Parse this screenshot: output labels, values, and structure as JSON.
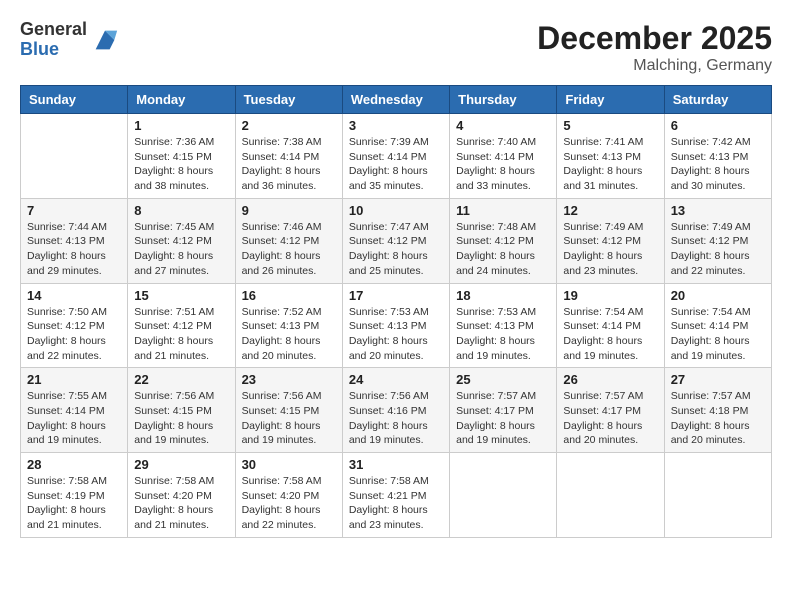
{
  "header": {
    "logo": {
      "general": "General",
      "blue": "Blue"
    },
    "title": "December 2025",
    "location": "Malching, Germany"
  },
  "weekdays": [
    "Sunday",
    "Monday",
    "Tuesday",
    "Wednesday",
    "Thursday",
    "Friday",
    "Saturday"
  ],
  "weeks": [
    [
      {
        "day": "",
        "info": ""
      },
      {
        "day": "1",
        "info": "Sunrise: 7:36 AM\nSunset: 4:15 PM\nDaylight: 8 hours\nand 38 minutes."
      },
      {
        "day": "2",
        "info": "Sunrise: 7:38 AM\nSunset: 4:14 PM\nDaylight: 8 hours\nand 36 minutes."
      },
      {
        "day": "3",
        "info": "Sunrise: 7:39 AM\nSunset: 4:14 PM\nDaylight: 8 hours\nand 35 minutes."
      },
      {
        "day": "4",
        "info": "Sunrise: 7:40 AM\nSunset: 4:14 PM\nDaylight: 8 hours\nand 33 minutes."
      },
      {
        "day": "5",
        "info": "Sunrise: 7:41 AM\nSunset: 4:13 PM\nDaylight: 8 hours\nand 31 minutes."
      },
      {
        "day": "6",
        "info": "Sunrise: 7:42 AM\nSunset: 4:13 PM\nDaylight: 8 hours\nand 30 minutes."
      }
    ],
    [
      {
        "day": "7",
        "info": "Sunrise: 7:44 AM\nSunset: 4:13 PM\nDaylight: 8 hours\nand 29 minutes."
      },
      {
        "day": "8",
        "info": "Sunrise: 7:45 AM\nSunset: 4:12 PM\nDaylight: 8 hours\nand 27 minutes."
      },
      {
        "day": "9",
        "info": "Sunrise: 7:46 AM\nSunset: 4:12 PM\nDaylight: 8 hours\nand 26 minutes."
      },
      {
        "day": "10",
        "info": "Sunrise: 7:47 AM\nSunset: 4:12 PM\nDaylight: 8 hours\nand 25 minutes."
      },
      {
        "day": "11",
        "info": "Sunrise: 7:48 AM\nSunset: 4:12 PM\nDaylight: 8 hours\nand 24 minutes."
      },
      {
        "day": "12",
        "info": "Sunrise: 7:49 AM\nSunset: 4:12 PM\nDaylight: 8 hours\nand 23 minutes."
      },
      {
        "day": "13",
        "info": "Sunrise: 7:49 AM\nSunset: 4:12 PM\nDaylight: 8 hours\nand 22 minutes."
      }
    ],
    [
      {
        "day": "14",
        "info": "Sunrise: 7:50 AM\nSunset: 4:12 PM\nDaylight: 8 hours\nand 22 minutes."
      },
      {
        "day": "15",
        "info": "Sunrise: 7:51 AM\nSunset: 4:12 PM\nDaylight: 8 hours\nand 21 minutes."
      },
      {
        "day": "16",
        "info": "Sunrise: 7:52 AM\nSunset: 4:13 PM\nDaylight: 8 hours\nand 20 minutes."
      },
      {
        "day": "17",
        "info": "Sunrise: 7:53 AM\nSunset: 4:13 PM\nDaylight: 8 hours\nand 20 minutes."
      },
      {
        "day": "18",
        "info": "Sunrise: 7:53 AM\nSunset: 4:13 PM\nDaylight: 8 hours\nand 19 minutes."
      },
      {
        "day": "19",
        "info": "Sunrise: 7:54 AM\nSunset: 4:14 PM\nDaylight: 8 hours\nand 19 minutes."
      },
      {
        "day": "20",
        "info": "Sunrise: 7:54 AM\nSunset: 4:14 PM\nDaylight: 8 hours\nand 19 minutes."
      }
    ],
    [
      {
        "day": "21",
        "info": "Sunrise: 7:55 AM\nSunset: 4:14 PM\nDaylight: 8 hours\nand 19 minutes."
      },
      {
        "day": "22",
        "info": "Sunrise: 7:56 AM\nSunset: 4:15 PM\nDaylight: 8 hours\nand 19 minutes."
      },
      {
        "day": "23",
        "info": "Sunrise: 7:56 AM\nSunset: 4:15 PM\nDaylight: 8 hours\nand 19 minutes."
      },
      {
        "day": "24",
        "info": "Sunrise: 7:56 AM\nSunset: 4:16 PM\nDaylight: 8 hours\nand 19 minutes."
      },
      {
        "day": "25",
        "info": "Sunrise: 7:57 AM\nSunset: 4:17 PM\nDaylight: 8 hours\nand 19 minutes."
      },
      {
        "day": "26",
        "info": "Sunrise: 7:57 AM\nSunset: 4:17 PM\nDaylight: 8 hours\nand 20 minutes."
      },
      {
        "day": "27",
        "info": "Sunrise: 7:57 AM\nSunset: 4:18 PM\nDaylight: 8 hours\nand 20 minutes."
      }
    ],
    [
      {
        "day": "28",
        "info": "Sunrise: 7:58 AM\nSunset: 4:19 PM\nDaylight: 8 hours\nand 21 minutes."
      },
      {
        "day": "29",
        "info": "Sunrise: 7:58 AM\nSunset: 4:20 PM\nDaylight: 8 hours\nand 21 minutes."
      },
      {
        "day": "30",
        "info": "Sunrise: 7:58 AM\nSunset: 4:20 PM\nDaylight: 8 hours\nand 22 minutes."
      },
      {
        "day": "31",
        "info": "Sunrise: 7:58 AM\nSunset: 4:21 PM\nDaylight: 8 hours\nand 23 minutes."
      },
      {
        "day": "",
        "info": ""
      },
      {
        "day": "",
        "info": ""
      },
      {
        "day": "",
        "info": ""
      }
    ]
  ]
}
